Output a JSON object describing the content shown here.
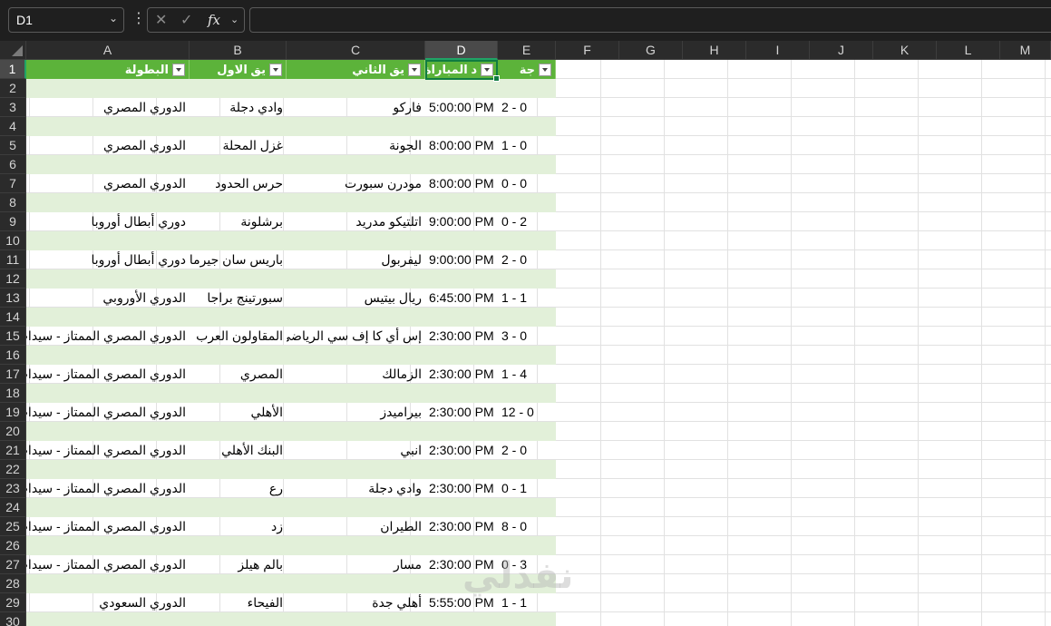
{
  "name_box": {
    "value": "D1"
  },
  "formula_bar": {
    "fx_label": "fx",
    "value": ""
  },
  "colors": {
    "header_green": "#5cb33a",
    "band_green": "#e2f0d9",
    "select_green": "#107c41"
  },
  "columns": [
    "A",
    "B",
    "C",
    "D",
    "E",
    "F",
    "G",
    "H",
    "I",
    "J",
    "K",
    "L",
    "M"
  ],
  "rows": [
    "1",
    "2",
    "3",
    "4",
    "5",
    "6",
    "7",
    "8",
    "9",
    "10",
    "11",
    "12",
    "13",
    "14",
    "15",
    "16",
    "17",
    "18",
    "19",
    "20",
    "21",
    "22",
    "23",
    "24",
    "25",
    "26",
    "27",
    "28",
    "29",
    "30"
  ],
  "table": {
    "headers": [
      "البطولة",
      "يق الاول",
      "يق الثاني",
      "د المباراة",
      "جة"
    ],
    "data": [
      [
        "الدوري المصري",
        "وادي دجلة",
        "فاركو",
        "5:00:00 PM",
        "2 - 0"
      ],
      [
        "الدوري المصري",
        "غزل المحلة",
        "الجونة",
        "8:00:00 PM",
        "1 - 0"
      ],
      [
        "الدوري المصري",
        "حرس الحدود",
        "مودرن سبورت",
        "8:00:00 PM",
        "0 - 0"
      ],
      [
        "دوري أبطال أوروبا",
        "برشلونة",
        "اتلتيكو مدريد",
        "9:00:00 PM",
        "0 - 2"
      ],
      [
        "دوري أبطال أوروبا",
        "باريس سان جيرمان",
        "ليفربول",
        "9:00:00 PM",
        "2 - 0"
      ],
      [
        "الدوري الأوروبي",
        "سبورتينج براجا",
        "ريال بيتيس",
        "6:45:00 PM",
        "1 - 1"
      ],
      [
        "الدوري المصري الممتاز - سيدات",
        "المقاولون العرب",
        "إس أي كا إف سي الرياضي",
        "2:30:00 PM",
        "3 - 0"
      ],
      [
        "الدوري المصري الممتاز - سيدات",
        "المصري",
        "الزمالك",
        "2:30:00 PM",
        "1 - 4"
      ],
      [
        "الدوري المصري الممتاز - سيدات",
        "الأهلي",
        "بيراميدز",
        "2:30:00 PM",
        "12 - 0"
      ],
      [
        "الدوري المصري الممتاز - سيدات",
        "البنك الأهلي",
        "انبي",
        "2:30:00 PM",
        "2 - 0"
      ],
      [
        "الدوري المصري الممتاز - سيدات",
        "رع",
        "وادي دجلة",
        "2:30:00 PM",
        "0 - 1"
      ],
      [
        "الدوري المصري الممتاز - سيدات",
        "زد",
        "الطيران",
        "2:30:00 PM",
        "8 - 0"
      ],
      [
        "الدوري المصري الممتاز - سيدات",
        "بالم هيلز",
        "مسار",
        "2:30:00 PM",
        "0 - 3"
      ],
      [
        "الدوري السعودي",
        "الفيحاء",
        "أهلي جدة",
        "5:55:00 PM",
        "1 - 1"
      ]
    ]
  },
  "watermark": "نفذلي"
}
